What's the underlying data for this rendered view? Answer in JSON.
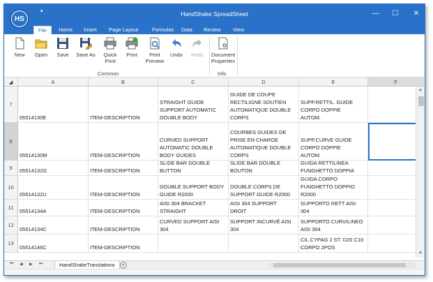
{
  "app": {
    "logo_text": "HS",
    "title": "HandShake SpreadSheet"
  },
  "window_controls": {
    "minimize": "—",
    "maximize": "☐",
    "close": "✕"
  },
  "quick_access": "▾",
  "tabs": [
    {
      "label": "File",
      "active": true
    },
    {
      "label": "Home"
    },
    {
      "label": "Insert"
    },
    {
      "label": "Page Layout"
    },
    {
      "label": "Formulas"
    },
    {
      "label": "Data"
    },
    {
      "label": "Review"
    },
    {
      "label": "View"
    }
  ],
  "ribbon": {
    "buttons": [
      {
        "label": "New",
        "icon": "new-document-icon"
      },
      {
        "label": "Open",
        "icon": "open-folder-icon"
      },
      {
        "label": "Save",
        "icon": "save-icon"
      },
      {
        "label": "Save As",
        "icon": "save-as-icon"
      },
      {
        "label": "Quick\nPrint",
        "icon": "quick-print-icon"
      },
      {
        "label": "Print",
        "icon": "print-icon"
      },
      {
        "label": "Print\nPreview",
        "icon": "print-preview-icon"
      },
      {
        "label": "Undo",
        "icon": "undo-icon"
      },
      {
        "label": "Redo",
        "icon": "redo-icon"
      },
      {
        "label": "Document\nProperties",
        "icon": "document-properties-icon"
      }
    ],
    "groups": [
      "Common",
      "Info"
    ]
  },
  "grid": {
    "columns": [
      "A",
      "B",
      "C",
      "D",
      "E",
      "F"
    ],
    "selected_column": "F",
    "rows": [
      {
        "num": "7",
        "cells": [
          "05514130E",
          "ITEM-DESCRIPTION",
          "STRAIGHT GUIDE\nSUPPORT AUTOMATIC\nDOUBLE BODY",
          "GUIDE DE COUPE\nRECTILIGNE SOUTIEN\nAUTOMATIQUE DOUBLE\nCORPS",
          "SUPP.RETTIL. GUIDE\nCORPO DOPPIE\nAUTOM.",
          ""
        ]
      },
      {
        "num": "8",
        "selected": true,
        "cells": [
          "05514130M",
          "ITEM-DESCRIPTION",
          "CURVED SUPPORT\nAUTOMATIC DOUBLE\nBODY GUIDES",
          "COURBES GUIDES DE\nPRISE EN CHARGE\nAUTOMATIQUE DOUBLE\nCORPS",
          "SUPP.CURVE GUIDE\nCORPO DOPPIE\nAUTOM.",
          ""
        ]
      },
      {
        "num": "9",
        "cells": [
          "05514132G",
          "ITEM-DESCRIPTION",
          "SLIDE BAR DOUBLE\nBUTTON",
          "SLIDE BAR DOUBLE\nBOUTON",
          "GUIDA RETTILINEA\nFUNGHETTO DOPPIA",
          ""
        ]
      },
      {
        "num": "10",
        "cells": [
          "05514132U",
          "ITEM-DESCRIPTION",
          "DOUBLE SUPPORT BODY\nGUIDE R2000",
          "DOUBLE CORPS DE\nSUPPORT GUIDE R2000",
          "GUIDA CORPO\nFUNGHETTO DOPPIO\nR2000",
          ""
        ]
      },
      {
        "num": "11",
        "cells": [
          "05514134A",
          "ITEM-DESCRIPTION",
          "AISI 304 BRACKET\nSTRAIGHT",
          "AISI 304 SUPPORT\nDROIT",
          "SUPPORTO RETT AISI\n304",
          ""
        ]
      },
      {
        "num": "12",
        "cells": [
          "05514134C",
          "ITEM-DESCRIPTION",
          "CURVED SUPPORT AISI\n304",
          "SUPPORT INCURVÉ AISI\n304",
          "SUPPORTO CURVILINEO\nAISI 304",
          ""
        ]
      },
      {
        "num": "13",
        "cells": [
          "05514146C",
          "ITEM-DESCRIPTION",
          "",
          "",
          "CIL.CYPAG 2 ST. D20 C10\nCORPO 2POS",
          ""
        ]
      }
    ]
  },
  "sheet": {
    "tab": "HandShakeTranslations",
    "add": "+"
  },
  "nav": {
    "first": "⏮",
    "prev": "◀",
    "next": "▶",
    "last": "⏭"
  }
}
